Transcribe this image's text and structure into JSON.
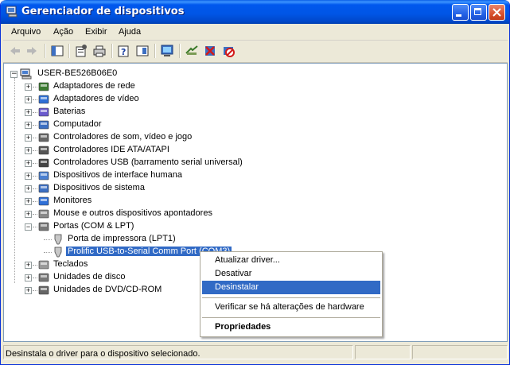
{
  "window": {
    "title": "Gerenciador de dispositivos"
  },
  "menu": [
    "Arquivo",
    "Ação",
    "Exibir",
    "Ajuda"
  ],
  "toolbar": {
    "icons": [
      "back-icon",
      "forward-icon",
      "show-hide-tree-icon",
      "properties-icon",
      "print-icon",
      "help-icon",
      "show-hide-console-icon",
      "scan-hardware-icon",
      "update-driver-icon",
      "uninstall-icon",
      "disable-icon"
    ]
  },
  "tree": {
    "root": "USER-BE526B06E0",
    "items": [
      {
        "label": "Adaptadores de rede",
        "icon": "network-adapter-icon"
      },
      {
        "label": "Adaptadores de vídeo",
        "icon": "display-adapter-icon"
      },
      {
        "label": "Baterias",
        "icon": "battery-icon"
      },
      {
        "label": "Computador",
        "icon": "computer-icon"
      },
      {
        "label": "Controladores de som, vídeo e jogo",
        "icon": "sound-icon"
      },
      {
        "label": "Controladores IDE ATA/ATAPI",
        "icon": "ide-controller-icon"
      },
      {
        "label": "Controladores USB (barramento serial universal)",
        "icon": "usb-icon"
      },
      {
        "label": "Dispositivos de interface humana",
        "icon": "hid-icon"
      },
      {
        "label": "Dispositivos de sistema",
        "icon": "system-device-icon"
      },
      {
        "label": "Monitores",
        "icon": "monitor-icon"
      },
      {
        "label": "Mouse e outros dispositivos apontadores",
        "icon": "mouse-icon"
      },
      {
        "label": "Portas (COM & LPT)",
        "icon": "port-icon"
      },
      {
        "label": "Teclados",
        "icon": "keyboard-icon"
      },
      {
        "label": "Unidades de disco",
        "icon": "disk-drive-icon"
      },
      {
        "label": "Unidades de DVD/CD-ROM",
        "icon": "dvd-icon"
      }
    ],
    "ports_children": [
      {
        "label": "Porta de impressora (LPT1)",
        "icon": "port-icon"
      },
      {
        "label": "Prolific USB-to-Serial Comm Port (COM3)",
        "icon": "port-icon",
        "selected": true
      }
    ]
  },
  "context_menu": {
    "items": [
      {
        "label": "Atualizar driver..."
      },
      {
        "label": "Desativar"
      },
      {
        "label": "Desinstalar",
        "highlighted": true
      },
      {
        "label": "Verificar se há alterações de hardware"
      },
      {
        "label": "Propriedades",
        "bold": true
      }
    ]
  },
  "status": {
    "text": "Desinstala o driver para o dispositivo selecionado."
  },
  "colors": {
    "titlebar": "#0058ee",
    "selection": "#316ac5",
    "face": "#ece9d8"
  }
}
